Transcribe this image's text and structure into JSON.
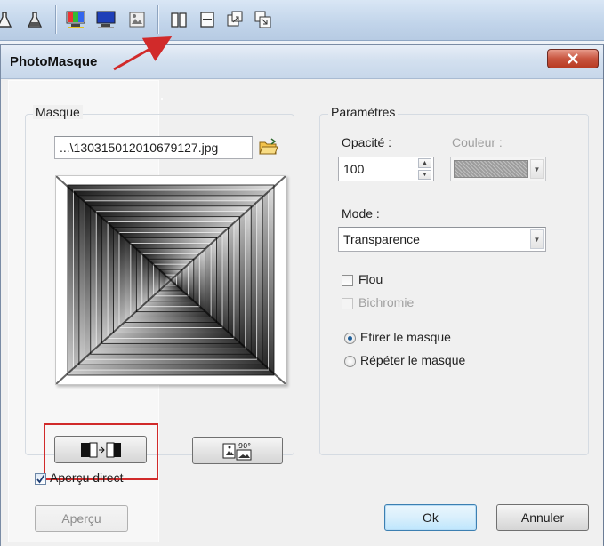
{
  "toolbar": {
    "icons": [
      "flask-icon",
      "flask-filled-icon",
      "color-monitor-icon",
      "blue-monitor-icon",
      "mask-icon",
      "book-icon",
      "page-icon",
      "image-export-icon",
      "image-import-icon"
    ]
  },
  "dialog": {
    "title": "PhotoMasque",
    "close_label": "X"
  },
  "masque": {
    "group_label": "Masque",
    "file_path": "...\\130315012010679127.jpg",
    "swap_icon": "swap-icon",
    "rotate_icon": "rotate-90-icon",
    "rotate_text": "90°"
  },
  "parametres": {
    "group_label": "Paramètres",
    "opacity_label": "Opacité :",
    "opacity_value": "100",
    "color_label": "Couleur :",
    "mode_label": "Mode :",
    "mode_value": "Transparence",
    "blur_label": "Flou",
    "blur_checked": false,
    "bichromie_label": "Bichromie",
    "bichromie_checked": false,
    "stretch_label": "Etirer le masque",
    "stretch_selected": true,
    "repeat_label": "Répéter le masque",
    "repeat_selected": false
  },
  "footer": {
    "live_preview_label": "Aperçu direct",
    "live_preview_checked": true,
    "preview_button": "Aperçu",
    "ok_button": "Ok",
    "cancel_button": "Annuler"
  },
  "colors": {
    "annotation_red": "#d12a2a",
    "default_button_border": "#3c7fb1"
  }
}
